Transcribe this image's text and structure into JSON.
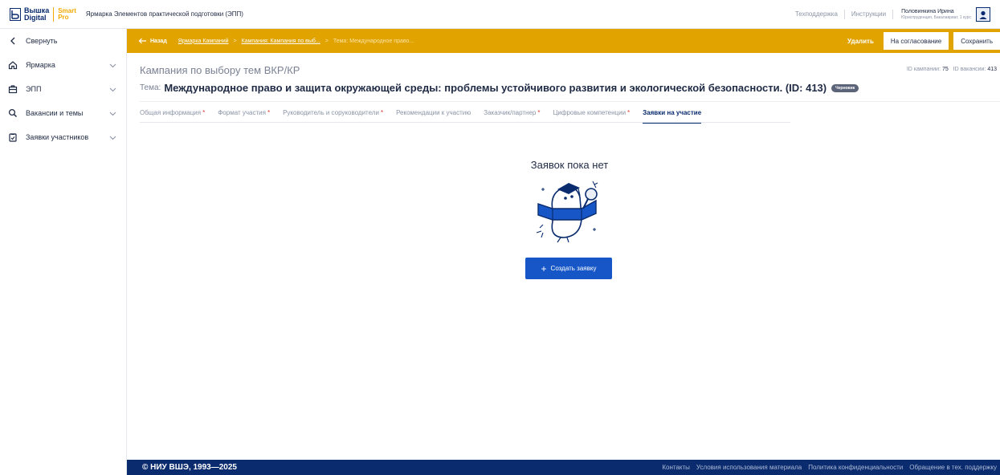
{
  "header": {
    "logo_line1": "Вышка",
    "logo_line2": "Digital",
    "logo_smart": "Smart",
    "logo_pro": "Pro",
    "app_title": "Ярмарка Элементов практической подготовки (ЭПП)",
    "links": [
      "Техподдержка",
      "Инструкции"
    ],
    "user_name": "Половинкина Ирина",
    "user_role": "Юриспруденция, Бакалавриат, 1 курс"
  },
  "sidebar": {
    "collapse_label": "Свернуть",
    "items": [
      {
        "label": "Ярмарка",
        "icon": "home-icon"
      },
      {
        "label": "ЭПП",
        "icon": "briefcase-icon"
      },
      {
        "label": "Вакансии и темы",
        "icon": "search-icon"
      },
      {
        "label": "Заявки участников",
        "icon": "clipboard-icon"
      }
    ]
  },
  "actionbar": {
    "back_label": "Назад",
    "breadcrumbs": [
      "Ярмарка Кампаний",
      "Кампания: Кампания по выб...",
      "Тема: Международное право..."
    ],
    "delete_label": "Удалить",
    "approve_label": "На согласование",
    "save_label": "Сохранить"
  },
  "campaign": {
    "title": "Кампания по выбору тем ВКР/КР",
    "id_campaign_label": "ID кампании:",
    "id_campaign": "75",
    "id_vacancy_label": "ID вакансии:",
    "id_vacancy": "413",
    "theme_label": "Тема:",
    "theme_text": "Международное право и защита окружающей среды: проблемы устойчивого развития и экологической безопасности. (ID: 413)",
    "status_badge": "Черновик"
  },
  "tabs": [
    {
      "label": "Общая информация",
      "required": true
    },
    {
      "label": "Формат участия",
      "required": true
    },
    {
      "label": "Руководитель и соруководители",
      "required": true
    },
    {
      "label": "Рекомендации к участию",
      "required": false
    },
    {
      "label": "Заказчик/партнер",
      "required": true
    },
    {
      "label": "Цифровые компетенции",
      "required": true
    },
    {
      "label": "Заявки на участие",
      "required": false,
      "active": true
    }
  ],
  "empty_state": {
    "title": "Заявок пока нет",
    "create_label": "Создать заявку"
  },
  "footer": {
    "copyright": "© НИУ ВШЭ, 1993—2025",
    "links": [
      "Контакты",
      "Условия использования материала",
      "Политика конфиденциальности",
      "Обращение в тех. поддержку"
    ]
  },
  "colors": {
    "brand_blue": "#0a2b6e",
    "accent_orange": "#e0a300",
    "button_blue": "#1656c6",
    "required_red": "#e53935"
  }
}
